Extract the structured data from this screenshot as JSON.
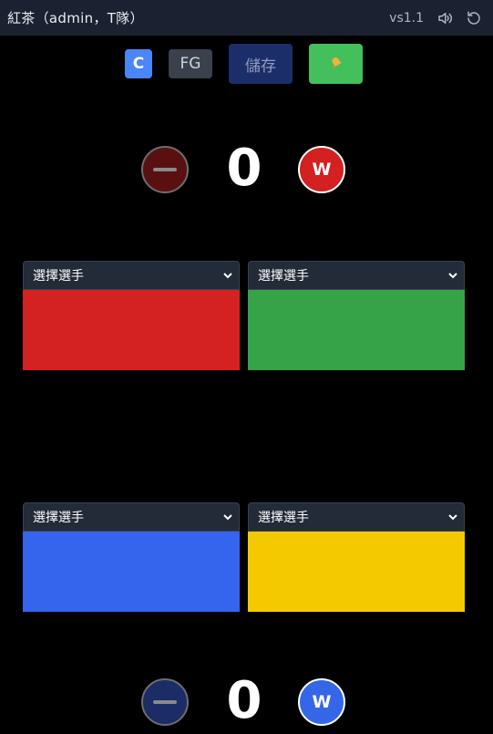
{
  "header": {
    "title": "紅茶（admin，T隊）",
    "version": "vs1.1",
    "sound_icon": "speaker-icon",
    "refresh_icon": "refresh-icon"
  },
  "toolbar": {
    "c_label": "C",
    "fg_label": "FG",
    "save_label": "儲存",
    "bell_icon": "bell-icon",
    "colors": {
      "c": "#4a86f7",
      "fg": "#3a414d",
      "save": "#1c2e6a",
      "bell": "#43bf5c"
    }
  },
  "top_team": {
    "score": "0",
    "minus_icon": "minus-icon",
    "win_label": "W",
    "color": "#d32020"
  },
  "bottom_team": {
    "score": "0",
    "minus_icon": "minus-icon",
    "win_label": "W",
    "color": "#3566e8"
  },
  "players": [
    {
      "placeholder": "選擇選手",
      "color": "#d42222"
    },
    {
      "placeholder": "選擇選手",
      "color": "#37a348"
    },
    {
      "placeholder": "選擇選手",
      "color": "#3565ec"
    },
    {
      "placeholder": "選擇選手",
      "color": "#f5c900"
    }
  ]
}
